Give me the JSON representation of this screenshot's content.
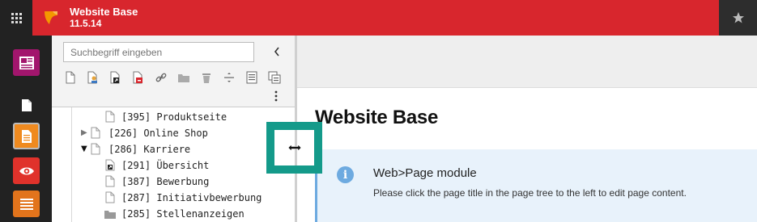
{
  "topbar": {
    "site_name": "Website Base",
    "version": "11.5.14",
    "colors": {
      "accent": "#d8262d",
      "dark": "#222222"
    }
  },
  "icons": {
    "apps": "grid-icon",
    "logo": "typo3-logo",
    "bookmark": "star-icon"
  },
  "module_menu": [
    {
      "name": "web-list-module",
      "color": "#a2166d"
    },
    {
      "name": "page-module",
      "color": "transparent"
    },
    {
      "name": "page-module-active",
      "color": "#ef8a1f"
    },
    {
      "name": "view-module",
      "color": "#e0322b"
    },
    {
      "name": "list-module",
      "color": "#e2741c"
    }
  ],
  "tree": {
    "search_placeholder": "Suchbegriff eingeben",
    "items": [
      {
        "label": "[395] Produktseite",
        "expander": ""
      },
      {
        "label": "[226] Online Shop",
        "expander": "▶"
      },
      {
        "label": "[286] Karriere",
        "expander": "▼"
      },
      {
        "label": "[291] Übersicht",
        "expander": ""
      },
      {
        "label": "[387] Bewerbung",
        "expander": ""
      },
      {
        "label": "[287] Initiativbewerbung",
        "expander": ""
      },
      {
        "label": "[285] Stellenanzeigen",
        "expander": ""
      }
    ]
  },
  "content": {
    "page_title": "Website Base",
    "info_title": "Web>Page module",
    "info_text": "Please click the page title in the page tree to the left to edit page content."
  },
  "highlight_color": "#149a8a"
}
